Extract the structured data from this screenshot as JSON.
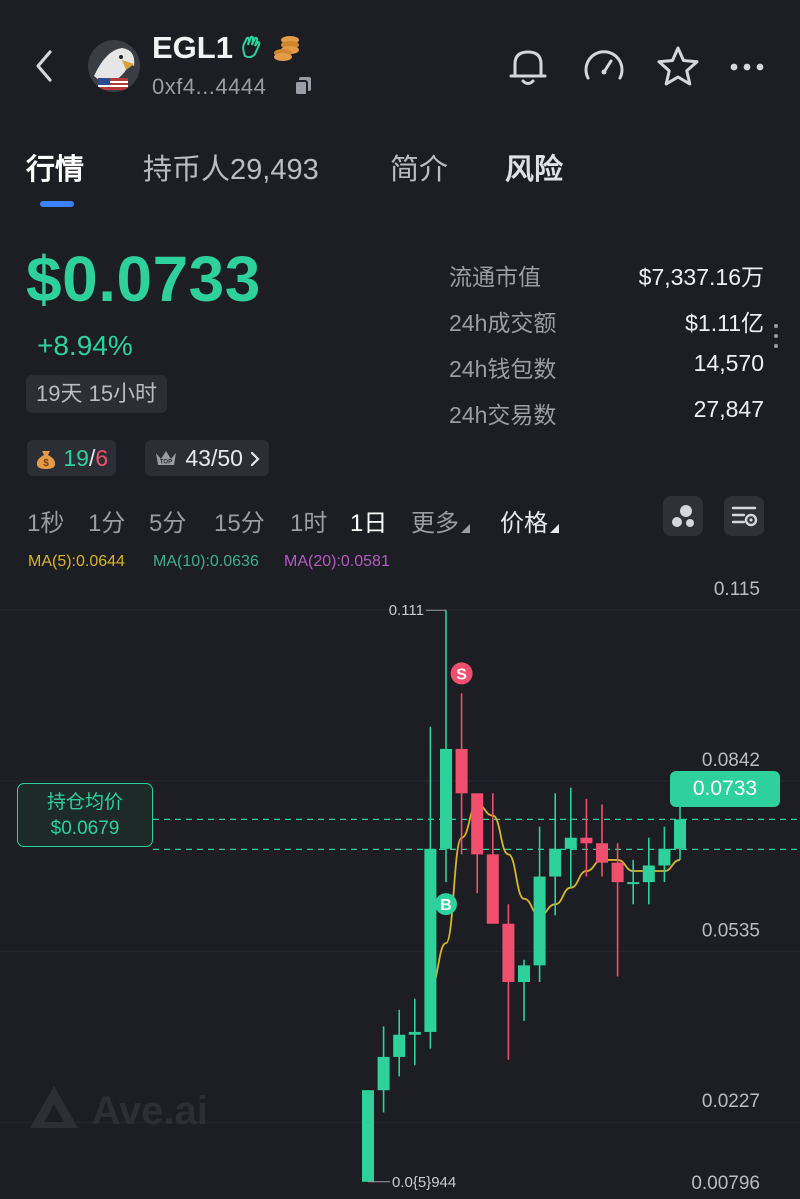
{
  "header": {
    "token_name": "EGL1",
    "address": "0xf4...4444",
    "icons": [
      "back-arrow-icon",
      "bell-icon",
      "gauge-icon",
      "star-icon",
      "more-icon"
    ]
  },
  "tabs": [
    {
      "label": "行情",
      "active": true
    },
    {
      "label": "持币人29,493",
      "active": false
    },
    {
      "label": "简介",
      "active": false
    },
    {
      "label": "风险",
      "active": false
    }
  ],
  "price": {
    "value": "$0.0733",
    "change": "+8.94%",
    "age": "19天 15小时"
  },
  "stats": [
    {
      "label": "流通市值",
      "value": "$7,337.16万"
    },
    {
      "label": "24h成交额",
      "value": "$1.11亿"
    },
    {
      "label": "24h钱包数",
      "value": "14,570"
    },
    {
      "label": "24h交易数",
      "value": "27,847"
    }
  ],
  "chips": {
    "snipers_buy": "19",
    "slash": "/",
    "snipers_sell": "6",
    "top_holders": "43/50"
  },
  "intervals": [
    {
      "label": "1秒"
    },
    {
      "label": "1分"
    },
    {
      "label": "5分"
    },
    {
      "label": "15分"
    },
    {
      "label": "1时"
    },
    {
      "label": "1日",
      "active": true
    },
    {
      "label": "更多"
    },
    {
      "label": "价格"
    }
  ],
  "ma": {
    "ma5": "MA(5):0.0644",
    "ma10": "MA(10):0.0636",
    "ma20": "MA(20):0.0581"
  },
  "colors": {
    "up": "#2ed19b",
    "down": "#f0506e",
    "ma5": "#d7b52e",
    "ma10": "#3fae8f",
    "ma20": "#b45bc4",
    "accent": "#3b82f6"
  },
  "chart_data": {
    "type": "candlestick",
    "y_ticks": [
      "0.115",
      "0.0842",
      "0.0535",
      "0.0227",
      "0.00796"
    ],
    "ylim": [
      0.00796,
      0.115
    ],
    "high_label": "0.111",
    "low_label": "0.0{5}944",
    "avg_cost_label": "持仓均价",
    "avg_cost_value": "$0.0679",
    "current_price": "0.0733",
    "sell_marker": "S",
    "buy_marker": "B",
    "candles": [
      {
        "o": 0.008,
        "h": 0.0245,
        "l": 0.008,
        "c": 0.0245
      },
      {
        "o": 0.0245,
        "h": 0.036,
        "l": 0.0205,
        "c": 0.0305
      },
      {
        "o": 0.0305,
        "h": 0.039,
        "l": 0.027,
        "c": 0.0345
      },
      {
        "o": 0.0345,
        "h": 0.041,
        "l": 0.029,
        "c": 0.035
      },
      {
        "o": 0.035,
        "h": 0.09,
        "l": 0.032,
        "c": 0.068
      },
      {
        "o": 0.068,
        "h": 0.111,
        "l": 0.062,
        "c": 0.086
      },
      {
        "o": 0.086,
        "h": 0.096,
        "l": 0.067,
        "c": 0.078
      },
      {
        "o": 0.078,
        "h": 0.078,
        "l": 0.06,
        "c": 0.067
      },
      {
        "o": 0.067,
        "h": 0.078,
        "l": 0.058,
        "c": 0.0545
      },
      {
        "o": 0.0545,
        "h": 0.058,
        "l": 0.03,
        "c": 0.044
      },
      {
        "o": 0.044,
        "h": 0.048,
        "l": 0.037,
        "c": 0.047
      },
      {
        "o": 0.047,
        "h": 0.072,
        "l": 0.044,
        "c": 0.063
      },
      {
        "o": 0.063,
        "h": 0.078,
        "l": 0.056,
        "c": 0.068
      },
      {
        "o": 0.068,
        "h": 0.079,
        "l": 0.061,
        "c": 0.07
      },
      {
        "o": 0.07,
        "h": 0.077,
        "l": 0.063,
        "c": 0.069
      },
      {
        "o": 0.069,
        "h": 0.076,
        "l": 0.063,
        "c": 0.0655
      },
      {
        "o": 0.0655,
        "h": 0.069,
        "l": 0.045,
        "c": 0.062
      },
      {
        "o": 0.062,
        "h": 0.066,
        "l": 0.058,
        "c": 0.062
      },
      {
        "o": 0.062,
        "h": 0.07,
        "l": 0.058,
        "c": 0.065
      },
      {
        "o": 0.065,
        "h": 0.072,
        "l": 0.062,
        "c": 0.068
      },
      {
        "o": 0.068,
        "h": 0.079,
        "l": 0.066,
        "c": 0.0733
      }
    ],
    "ma5": [
      null,
      null,
      null,
      null,
      0.043,
      0.051,
      0.07,
      0.076,
      0.074,
      0.067,
      0.059,
      0.056,
      0.058,
      0.061,
      0.064,
      0.066,
      0.066,
      0.064,
      0.064,
      0.064,
      0.066
    ],
    "grid": true
  },
  "watermark": "Ave.ai"
}
